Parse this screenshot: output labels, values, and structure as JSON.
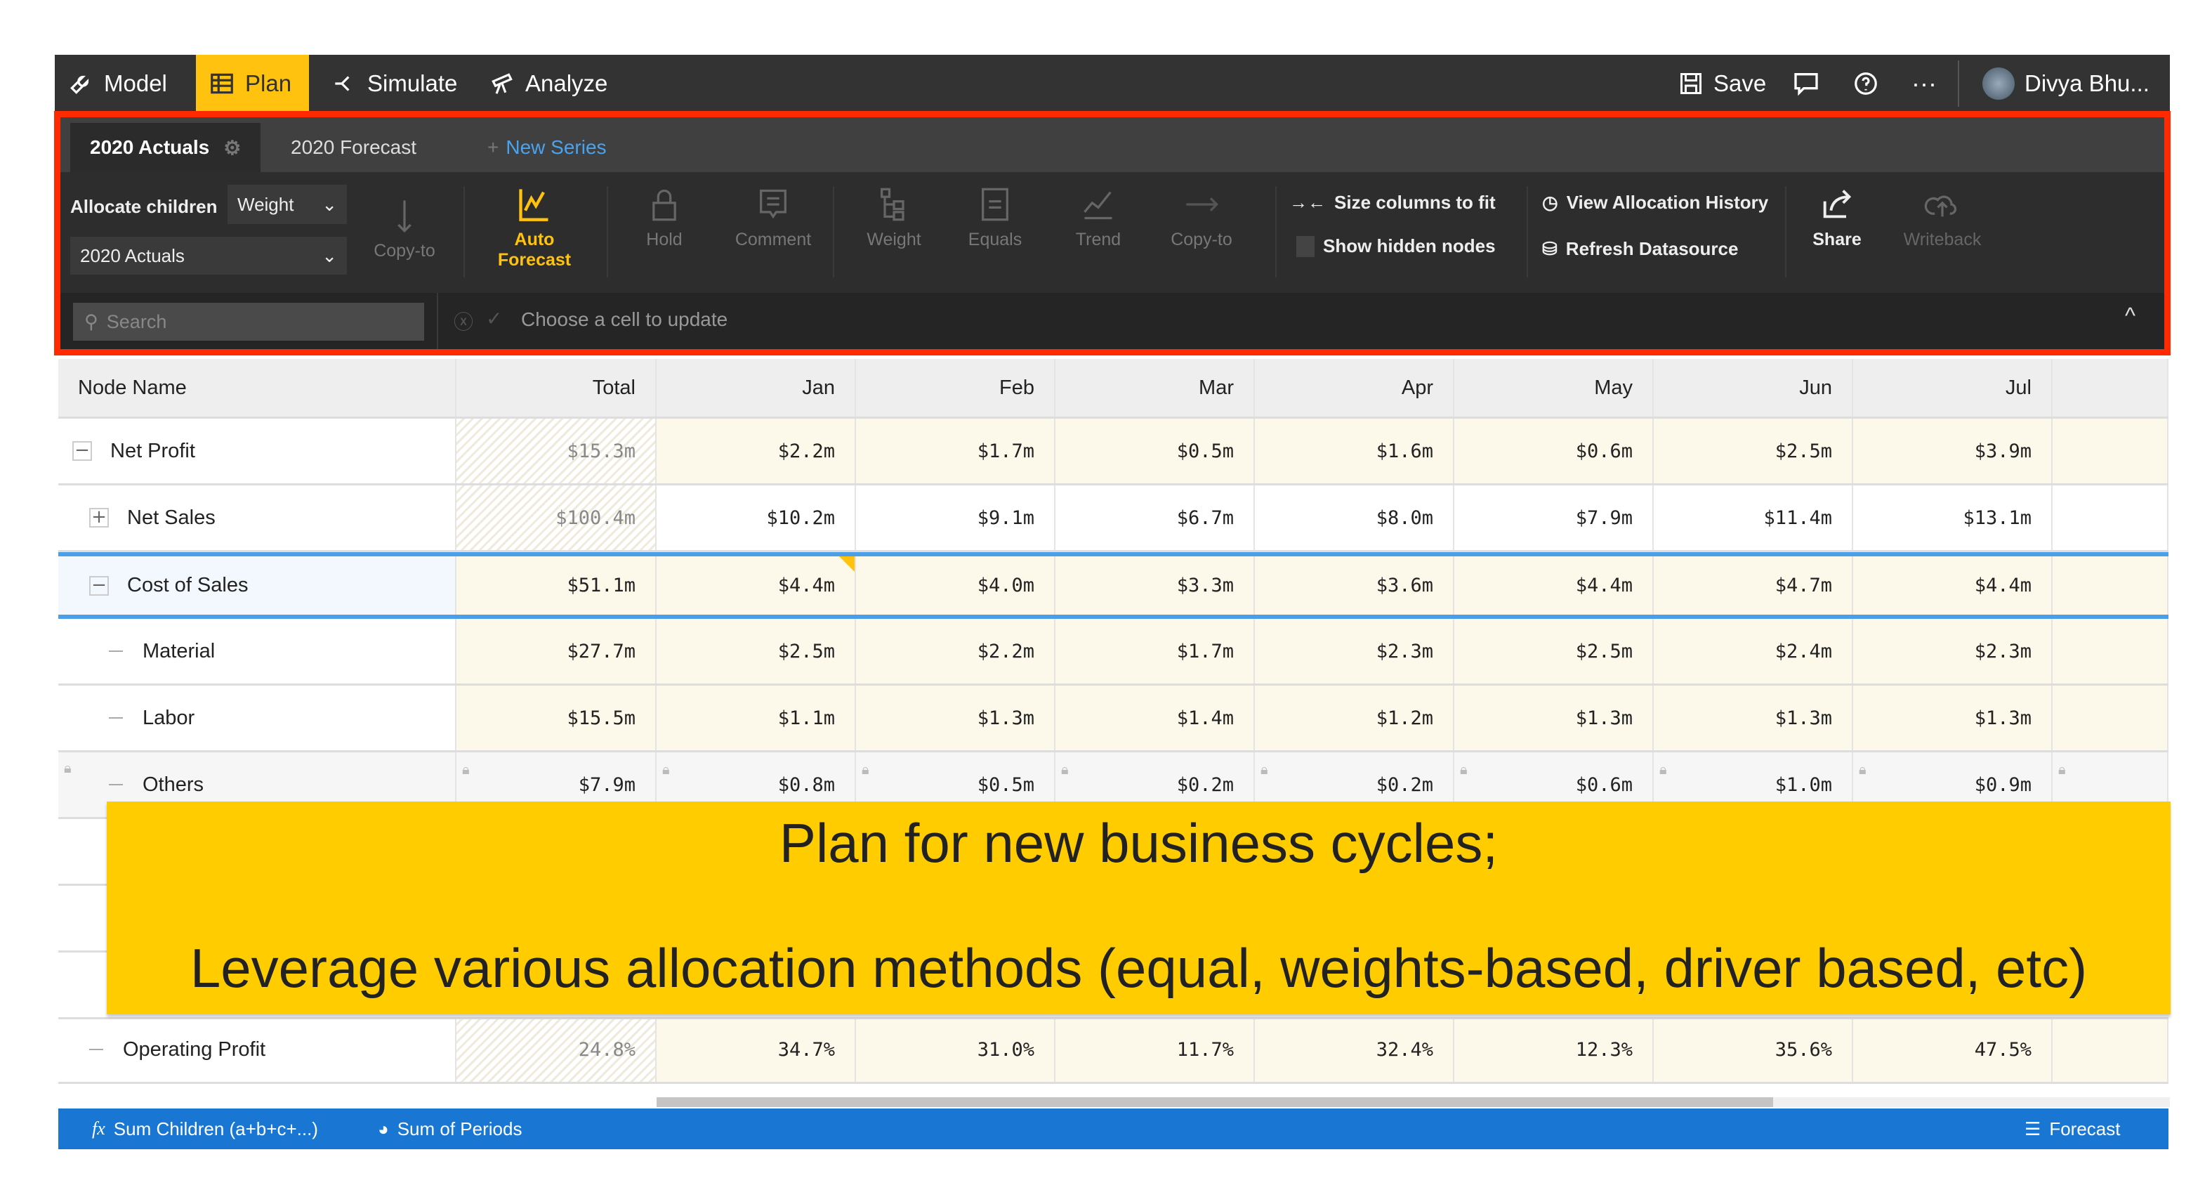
{
  "nav": {
    "tabs": [
      {
        "label": "Model",
        "icon": "wrench-icon"
      },
      {
        "label": "Plan",
        "icon": "grid-icon",
        "active": true
      },
      {
        "label": "Simulate",
        "icon": "branch-icon"
      },
      {
        "label": "Analyze",
        "icon": "telescope-icon"
      }
    ],
    "save": "Save",
    "user": "Divya Bhu..."
  },
  "series": {
    "tabs": [
      "2020 Actuals",
      "2020 Forecast"
    ],
    "new": "New Series"
  },
  "toolbar": {
    "allocate_label": "Allocate children",
    "allocate_method": "Weight",
    "source": "2020 Actuals",
    "tools": [
      "Copy-to",
      "Auto Forecast",
      "Hold",
      "Comment",
      "Weight",
      "Equals",
      "Trend",
      "Copy-to"
    ],
    "size_cols": "Size columns to fit",
    "show_hidden": "Show hidden nodes",
    "view_history": "View Allocation History",
    "refresh": "Refresh Datasource",
    "share": "Share",
    "writeback": "Writeback"
  },
  "search": {
    "placeholder": "Search",
    "status": "Choose a cell to update"
  },
  "table": {
    "columns": [
      "Node Name",
      "Total",
      "Jan",
      "Feb",
      "Mar",
      "Apr",
      "May",
      "Jun",
      "Jul"
    ],
    "rows": [
      {
        "name": "Net Profit",
        "expander": "minus",
        "values": [
          "$15.3m",
          "$2.2m",
          "$1.7m",
          "$0.5m",
          "$1.6m",
          "$0.6m",
          "$2.5m",
          "$3.9m"
        ]
      },
      {
        "name": "Net Sales",
        "expander": "plus",
        "values": [
          "$100.4m",
          "$10.2m",
          "$9.1m",
          "$6.7m",
          "$8.0m",
          "$7.9m",
          "$11.4m",
          "$13.1m"
        ]
      },
      {
        "name": "Cost of Sales",
        "expander": "minus",
        "selected": true,
        "values": [
          "$51.1m",
          "$4.4m",
          "$4.0m",
          "$3.3m",
          "$3.6m",
          "$4.4m",
          "$4.7m",
          "$4.4m"
        ]
      },
      {
        "name": "Material",
        "expander": "dash",
        "values": [
          "$27.7m",
          "$2.5m",
          "$2.2m",
          "$1.7m",
          "$2.3m",
          "$2.5m",
          "$2.4m",
          "$2.3m"
        ]
      },
      {
        "name": "Labor",
        "expander": "dash",
        "values": [
          "$15.5m",
          "$1.1m",
          "$1.3m",
          "$1.4m",
          "$1.2m",
          "$1.3m",
          "$1.3m",
          "$1.3m"
        ]
      },
      {
        "name": "Others",
        "expander": "dash",
        "locked": true,
        "values": [
          "$7.9m",
          "$0.8m",
          "$0.5m",
          "$0.2m",
          "$0.2m",
          "$0.6m",
          "$1.0m",
          "$0.9m"
        ]
      },
      {
        "name": "Operating Profit",
        "expander": "dash",
        "values": [
          "24.8%",
          "34.7%",
          "31.0%",
          "11.7%",
          "32.4%",
          "12.3%",
          "35.6%",
          "47.5%"
        ]
      }
    ]
  },
  "overlay": {
    "line1": "Plan for new business cycles;",
    "line2": "Leverage various allocation methods (equal, weights-based, driver based, etc)"
  },
  "footer": {
    "formula": "Sum Children (a+b+c+...)",
    "periods": "Sum of Periods",
    "series": "Forecast"
  },
  "colors": {
    "accent": "#ffc20e",
    "highlight_border": "#ff2a00",
    "footer": "#1976d2",
    "overlay": "#ffcc00",
    "selection": "#4a9fe8"
  }
}
